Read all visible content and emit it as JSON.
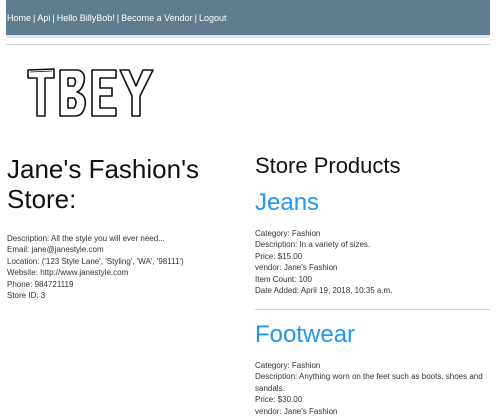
{
  "nav": {
    "links": [
      "Home",
      "Api",
      "Hello BillyBob!",
      "Become a Vendor",
      "Logout"
    ],
    "separator": "|"
  },
  "logo": {
    "text": "TBEY"
  },
  "store": {
    "title": "Jane's Fashion's Store:",
    "description": "Description: All the style you will ever need...",
    "email": "Email: jane@janestyle.com",
    "location": "Location: ('123 Style Lane', 'Styling', 'WA', '98111')",
    "website": "Website: http://www.janestyle.com",
    "phone": "Phone: 984721119",
    "store_id": "Store ID: 3"
  },
  "products": {
    "heading": "Store Products",
    "items": [
      {
        "name": "Jeans",
        "category": "Category: Fashion",
        "description": "Description: In a variety of sizes.",
        "price": "Price: $15.00",
        "vendor": "vendor: Jane's Fashion",
        "item_count": "Item Count: 100",
        "date_added": "Date Added: April 19, 2018, 10:35 a.m."
      },
      {
        "name": "Footwear",
        "category": "Category: Fashion",
        "description": "Description: Anything worn on the feet such as boots, shoes and sandals.",
        "price": "Price: $30.00",
        "vendor": "vendor: Jane's Fashion"
      }
    ]
  },
  "colors": {
    "navbar": "#5f7d8f",
    "product_link": "#2196f3"
  }
}
